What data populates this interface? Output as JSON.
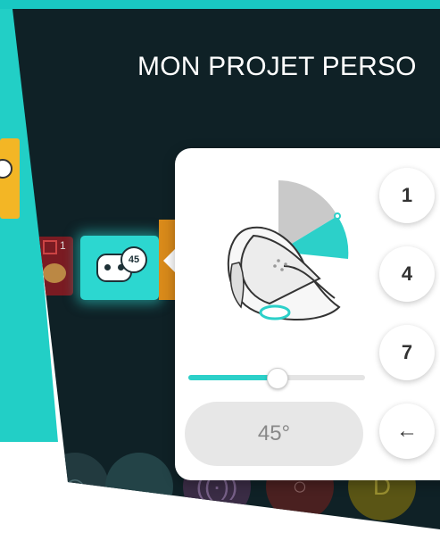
{
  "header": {
    "title": "MON PROJET PERSO"
  },
  "blocks": {
    "red_block_number": "1",
    "speech_bubble_value": "45"
  },
  "angle_editor": {
    "angle_display": "45°",
    "slider_value_percent": 50,
    "keypad": [
      "1",
      "4",
      "7",
      "←"
    ]
  },
  "icons": {
    "palette": [
      "camera-icon",
      "chat-icon",
      "signal-icon",
      "circle-icon",
      "bolt-icon"
    ]
  },
  "colors": {
    "accent_cyan": "#2cd0c9",
    "background_dark": "#0f2126",
    "yellow_block": "#f3b625",
    "red_block": "#7a1b22"
  }
}
